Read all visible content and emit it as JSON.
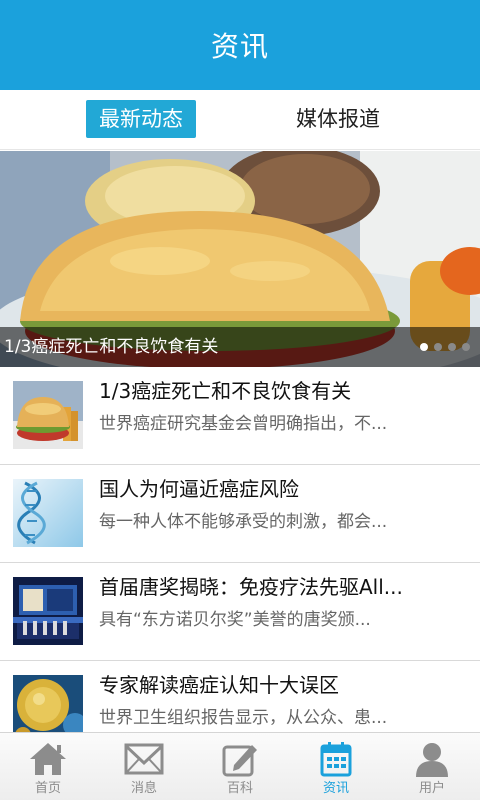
{
  "header": {
    "title": "资讯"
  },
  "tabs": [
    {
      "label": "最新动态",
      "active": true
    },
    {
      "label": "媒体报道",
      "active": false
    }
  ],
  "banner": {
    "caption": "1/3癌症死亡和不良饮食有关",
    "dots": 4,
    "active_dot": 0
  },
  "news": [
    {
      "title": "1/3癌症死亡和不良饮食有关",
      "summary": "世界癌症研究基金会曾明确指出，不...",
      "thumb": "burger"
    },
    {
      "title": "国人为何逼近癌症风险",
      "summary": "每一种人体不能够承受的刺激，都会...",
      "thumb": "dna"
    },
    {
      "title": "首届唐奖揭晓：免疫疗法先驱All...",
      "summary": "具有“东方诺贝尔奖”美誉的唐奖颁...",
      "thumb": "ceremony"
    },
    {
      "title": "专家解读癌症认知十大误区",
      "summary": "世界卫生组织报告显示，从公众、患...",
      "thumb": "cell"
    }
  ],
  "bottom_nav": [
    {
      "label": "首页",
      "icon": "home-icon",
      "active": false
    },
    {
      "label": "消息",
      "icon": "mail-icon",
      "active": false
    },
    {
      "label": "百科",
      "icon": "edit-icon",
      "active": false
    },
    {
      "label": "资讯",
      "icon": "calendar-icon",
      "active": true
    },
    {
      "label": "用户",
      "icon": "user-icon",
      "active": false
    }
  ],
  "colors": {
    "header": "#1ba1dc",
    "tab_active": "#22a8d6",
    "nav_active": "#1ba1dc",
    "nav_inactive": "#8c8c8c"
  }
}
